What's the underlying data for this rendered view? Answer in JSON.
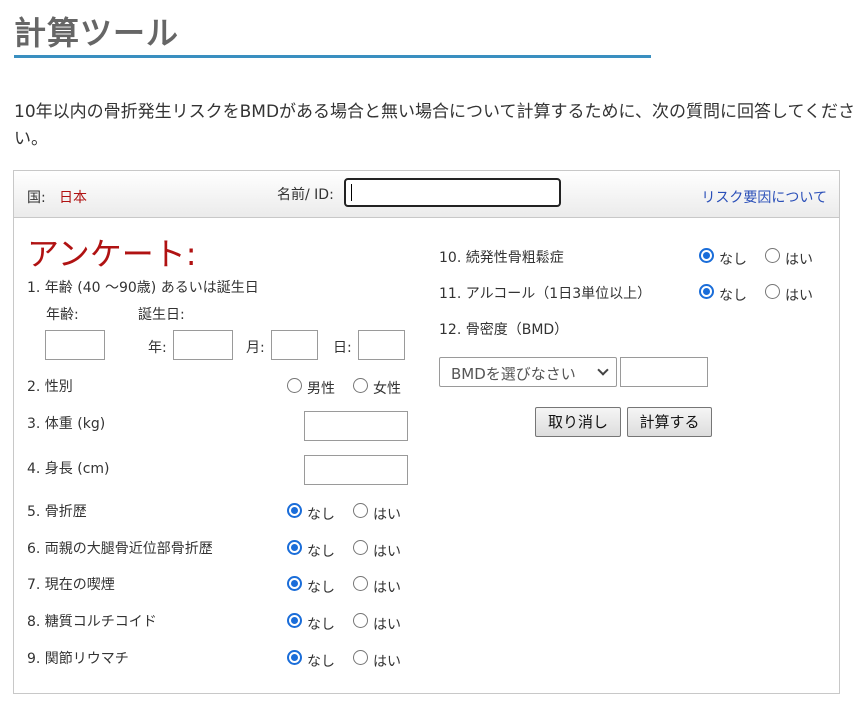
{
  "header": {
    "title": "計算ツール",
    "intro": "10年以内の骨折発生リスクをBMDがある場合と無い場合について計算するために、次の質問に回答してください。"
  },
  "topbar": {
    "country_label": "国:",
    "country_value": "日本",
    "name_label": "名前/ ID:",
    "name_value": "",
    "risk_link": "リスク要因について"
  },
  "questionnaire": {
    "heading": "アンケート:",
    "q1": {
      "label": "1. 年齢 (40 〜90歳) あるいは誕生日",
      "age_label": "年齢:",
      "birthday_label": "誕生日:",
      "year_label": "年:",
      "month_label": "月:",
      "day_label": "日:"
    },
    "q2": {
      "label": "2. 性別",
      "male": "男性",
      "female": "女性"
    },
    "q3": {
      "label": "3. 体重 (kg)"
    },
    "q4": {
      "label": "4. 身長 (cm)"
    },
    "yes_no": {
      "no": "なし",
      "yes": "はい"
    },
    "q5": {
      "label": "5. 骨折歴"
    },
    "q6": {
      "label": "6. 両親の大腿骨近位部骨折歴"
    },
    "q7": {
      "label": "7. 現在の喫煙"
    },
    "q8": {
      "label": "8. 糖質コルチコイド"
    },
    "q9": {
      "label": "9. 関節リウマチ"
    },
    "q10": {
      "label": "10. 続発性骨粗鬆症"
    },
    "q11": {
      "label": "11. アルコール（1日3単位以上）"
    },
    "q12": {
      "label": "12. 骨密度（BMD）",
      "select_value": "BMDを選びなさい"
    }
  },
  "buttons": {
    "cancel": "取り消し",
    "calculate": "計算する"
  }
}
